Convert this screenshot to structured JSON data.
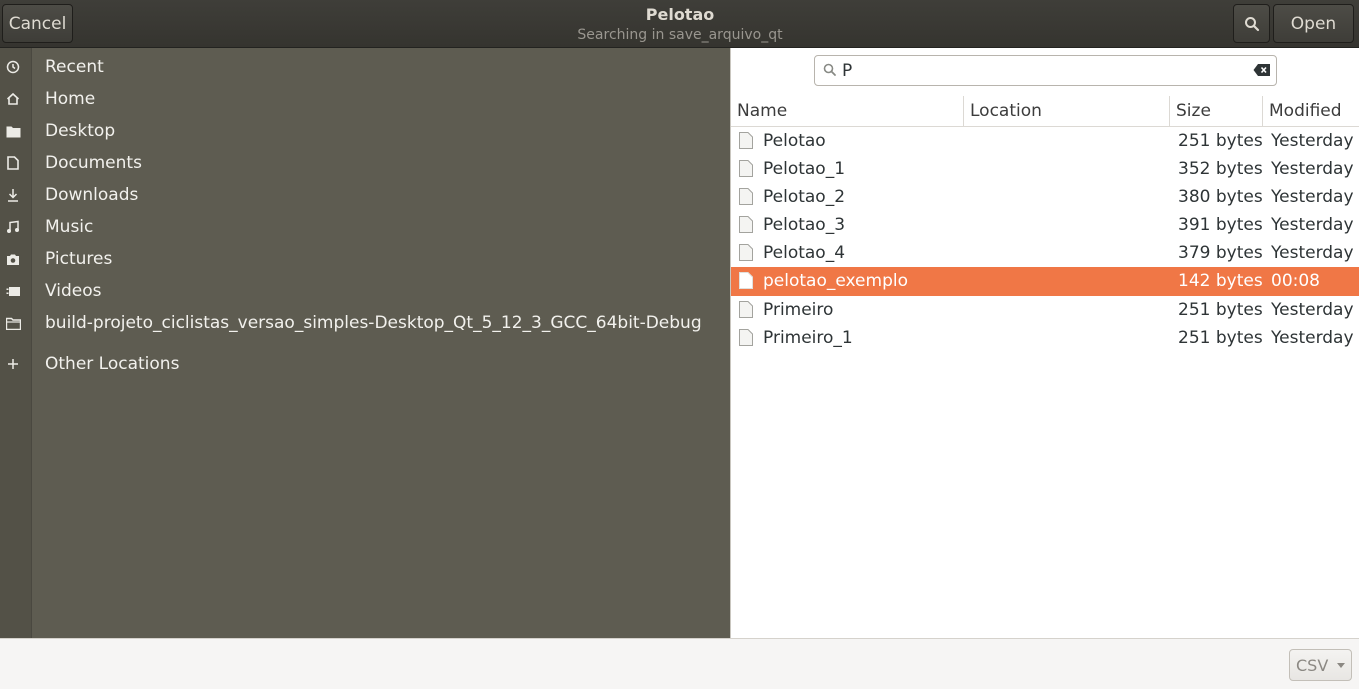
{
  "header": {
    "cancel_label": "Cancel",
    "title": "Pelotao",
    "subtitle": "Searching in save_arquivo_qt",
    "open_label": "Open"
  },
  "sidebar": {
    "items": [
      {
        "label": "Recent",
        "icon": "clock-icon"
      },
      {
        "label": "Home",
        "icon": "home-icon"
      },
      {
        "label": "Desktop",
        "icon": "folder-icon"
      },
      {
        "label": "Documents",
        "icon": "document-icon"
      },
      {
        "label": "Downloads",
        "icon": "download-icon"
      },
      {
        "label": "Music",
        "icon": "music-icon"
      },
      {
        "label": "Pictures",
        "icon": "camera-icon"
      },
      {
        "label": "Videos",
        "icon": "video-icon"
      },
      {
        "label": "build-projeto_ciclistas_versao_simples-Desktop_Qt_5_12_3_GCC_64bit-Debug",
        "icon": "folder-icon"
      },
      {
        "label": "Other Locations",
        "icon": "plus-icon"
      }
    ]
  },
  "search": {
    "value": "P"
  },
  "columns": {
    "name": "Name",
    "location": "Location",
    "size": "Size",
    "modified": "Modified"
  },
  "files": [
    {
      "name": "Pelotao",
      "location": "",
      "size": "251 bytes",
      "modified": "Yesterday"
    },
    {
      "name": "Pelotao_1",
      "location": "",
      "size": "352 bytes",
      "modified": "Yesterday"
    },
    {
      "name": "Pelotao_2",
      "location": "",
      "size": "380 bytes",
      "modified": "Yesterday"
    },
    {
      "name": "Pelotao_3",
      "location": "",
      "size": "391 bytes",
      "modified": "Yesterday"
    },
    {
      "name": "Pelotao_4",
      "location": "",
      "size": "379 bytes",
      "modified": "Yesterday"
    },
    {
      "name": "pelotao_exemplo",
      "location": "",
      "size": "142 bytes",
      "modified": "00:08",
      "selected": true
    },
    {
      "name": "Primeiro",
      "location": "",
      "size": "251 bytes",
      "modified": "Yesterday"
    },
    {
      "name": "Primeiro_1",
      "location": "",
      "size": "251 bytes",
      "modified": "Yesterday"
    }
  ],
  "filter": {
    "selected": "CSV"
  },
  "colors": {
    "selection": "#f07746",
    "sidebar_bg": "#5e5c51",
    "headerbar_bg": "#3c3b37"
  }
}
